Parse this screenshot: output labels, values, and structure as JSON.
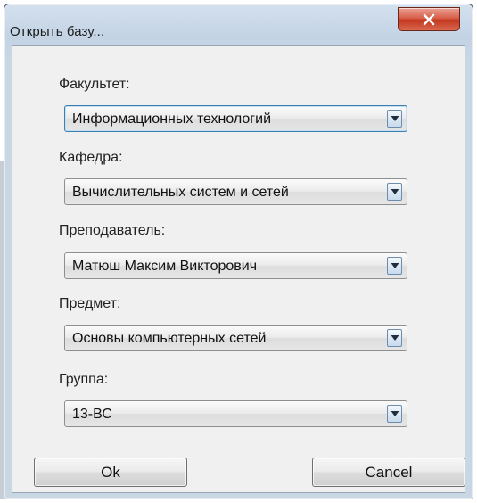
{
  "window": {
    "title": "Открыть базу..."
  },
  "fields": [
    {
      "label": "Факультет:",
      "value": "Информационных технологий"
    },
    {
      "label": "Кафедра:",
      "value": "Вычислительных систем и сетей"
    },
    {
      "label": "Преподаватель:",
      "value": "Матюш Максим Викторович"
    },
    {
      "label": "Предмет:",
      "value": "Основы компьютерных сетей"
    },
    {
      "label": "Группа:",
      "value": "13-ВС"
    }
  ],
  "buttons": {
    "ok_label": "Ok",
    "cancel_label": "Cancel"
  },
  "colors": {
    "close_button": "#c9432c",
    "focus_border": "#3c7fb1",
    "dialog_background": "#f0f0f0",
    "frame": "#c3d3e4"
  },
  "icons": {
    "close": "close-x-icon",
    "dropdown": "dropdown-arrow-icon"
  }
}
